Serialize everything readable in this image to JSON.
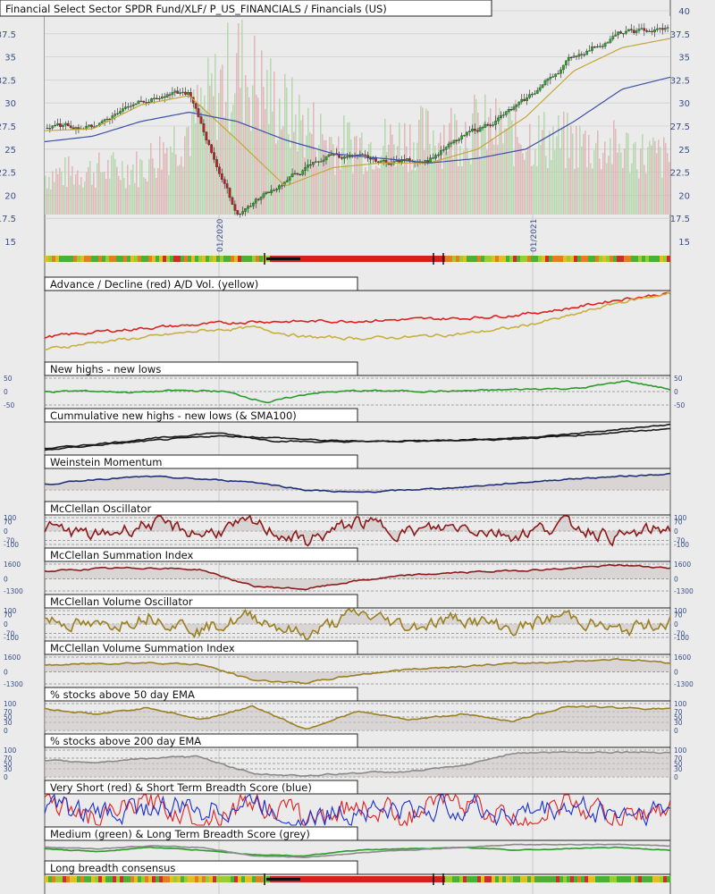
{
  "chart_data": [
    {
      "type": "candlestick",
      "title": "Financial Select Sector SPDR Fund/XLF/ P_US_FINANCIALS / Financials (US)",
      "y_ticks": [
        "40",
        "37.5",
        "35",
        "32.5",
        "30",
        "27.5",
        "25",
        "22.5",
        "20",
        "17.5",
        "15"
      ],
      "ylim": [
        15,
        40
      ],
      "x_date_labels": [
        "01/2020",
        "01/2021"
      ],
      "series": [
        {
          "name": "",
          "role": "price",
          "x": [
            "2019-07",
            "2019-10",
            "2020-01",
            "2020-02",
            "2020-03",
            "2020-04",
            "2020-06",
            "2020-08",
            "2020-10",
            "2020-11",
            "2021-01",
            "2021-03",
            "2021-05",
            "2021-06"
          ],
          "values": [
            27.3,
            27.5,
            30.5,
            31.0,
            18.0,
            21.5,
            24.5,
            23.5,
            24.0,
            27.0,
            30.0,
            35.0,
            37.5,
            38.0
          ]
        },
        {
          "name": "",
          "role": "sma50",
          "color": "#c4a63a",
          "values": [
            27.0,
            27.2,
            29.8,
            30.8,
            26.0,
            21.0,
            23.0,
            23.5,
            23.5,
            25.0,
            28.5,
            33.5,
            36.0,
            37.0
          ]
        },
        {
          "name": "",
          "role": "sma200",
          "color": "#3c50a8",
          "values": [
            25.8,
            26.4,
            28.0,
            29.0,
            28.0,
            26.0,
            24.5,
            24.0,
            23.5,
            24.0,
            25.0,
            28.0,
            31.5,
            32.8
          ]
        }
      ],
      "grid": true
    },
    {
      "type": "line",
      "title": "Advance / Decline (red) A/D Vol. (yellow)",
      "series": [
        {
          "name": "Advance / Decline",
          "color": "#e02020",
          "values": [
            0.3,
            0.38,
            0.45,
            0.5,
            0.55,
            0.55,
            0.56,
            0.58,
            0.6,
            0.65,
            0.75,
            0.9,
            1.0
          ]
        },
        {
          "name": "A/D Vol.",
          "color": "#c8b040",
          "values": [
            0.1,
            0.22,
            0.3,
            0.4,
            0.45,
            0.3,
            0.28,
            0.3,
            0.35,
            0.45,
            0.62,
            0.85,
            1.0
          ]
        }
      ]
    },
    {
      "type": "line",
      "title": "New highs - new lows",
      "y_ticks": [
        "50",
        "0",
        "-50"
      ],
      "ylim": [
        -50,
        50
      ],
      "series": [
        {
          "name": "",
          "color": "#2a9a2a",
          "values": [
            0,
            2,
            -3,
            4,
            1,
            -40,
            -5,
            3,
            2,
            1,
            5,
            10,
            12,
            40,
            8
          ]
        }
      ]
    },
    {
      "type": "line",
      "title": "Cummulative new highs - new lows (& SMA100)",
      "series": [
        {
          "name": "",
          "color": "#1a1a1a",
          "values": [
            0.1,
            0.3,
            0.5,
            0.7,
            0.4,
            0.35,
            0.38,
            0.42,
            0.48,
            0.6,
            0.8,
            1.0
          ]
        },
        {
          "name": "",
          "color": "#1a1a1a",
          "values": [
            0.05,
            0.25,
            0.42,
            0.58,
            0.52,
            0.4,
            0.38,
            0.4,
            0.45,
            0.55,
            0.7,
            0.85
          ]
        }
      ]
    },
    {
      "type": "line",
      "title": "Weinstein Momentum",
      "series": [
        {
          "name": "",
          "color": "#1f2f7a",
          "values": [
            0.5,
            0.7,
            0.8,
            0.7,
            0.6,
            0.3,
            0.2,
            0.3,
            0.4,
            0.55,
            0.7,
            0.8,
            0.9
          ]
        }
      ]
    },
    {
      "type": "line",
      "title": "McClellan Oscillator",
      "y_ticks": [
        "100",
        "70",
        "0",
        "-70",
        "-100"
      ],
      "ylim": [
        -100,
        100
      ],
      "series": [
        {
          "name": "",
          "color": "#8c1a1a",
          "values": [
            30,
            -40,
            60,
            -20,
            50,
            -80,
            70,
            -10,
            40,
            -30,
            60,
            -50,
            30
          ]
        }
      ]
    },
    {
      "type": "line",
      "title": "McClellan Summation Index",
      "y_ticks": [
        "1600",
        "0",
        "-1300"
      ],
      "ylim": [
        -1300,
        1600
      ],
      "series": [
        {
          "name": "",
          "color": "#8c1a1a",
          "values": [
            800,
            1100,
            1200,
            1000,
            -800,
            -1100,
            -200,
            400,
            700,
            900,
            1100,
            1500,
            1200
          ]
        }
      ]
    },
    {
      "type": "line",
      "title": "McClellan Volume Oscillator",
      "y_ticks": [
        "100",
        "70",
        "0",
        "-70",
        "-100"
      ],
      "ylim": [
        -100,
        100
      ],
      "series": [
        {
          "name": "",
          "color": "#9a8020",
          "values": [
            40,
            -30,
            70,
            -40,
            60,
            -90,
            80,
            -20,
            50,
            -40,
            70,
            -60,
            30
          ]
        }
      ]
    },
    {
      "type": "line",
      "title": "McClellan Volume Summation Index",
      "y_ticks": [
        "1600",
        "0",
        "-1300"
      ],
      "ylim": [
        -1300,
        1600
      ],
      "series": [
        {
          "name": "",
          "color": "#9a8020",
          "values": [
            700,
            900,
            1000,
            800,
            -900,
            -1200,
            -300,
            300,
            600,
            900,
            1100,
            1400,
            1000
          ]
        }
      ]
    },
    {
      "type": "line",
      "title": "% stocks above 50 day EMA",
      "y_ticks": [
        "100",
        "70",
        "50",
        "30",
        "0"
      ],
      "ylim": [
        0,
        100
      ],
      "series": [
        {
          "name": "",
          "color": "#9a8020",
          "values": [
            80,
            60,
            85,
            40,
            90,
            5,
            70,
            40,
            60,
            35,
            90,
            85,
            80
          ]
        }
      ]
    },
    {
      "type": "line",
      "title": "% stocks above 200 day EMA",
      "y_ticks": [
        "100",
        "70",
        "50",
        "30",
        "0"
      ],
      "ylim": [
        0,
        100
      ],
      "series": [
        {
          "name": "",
          "color": "#8a8a8a",
          "values": [
            60,
            55,
            70,
            75,
            10,
            5,
            15,
            20,
            40,
            90,
            92,
            93,
            92
          ]
        }
      ]
    },
    {
      "type": "line",
      "title": "Very Short (red) & Short Term Breadth Score (blue)",
      "series": [
        {
          "name": "Very Short",
          "color": "#e02020",
          "values": [
            0.9,
            0.1,
            0.8,
            0.2,
            0.9,
            0.1,
            0.7,
            0.3,
            0.9,
            0.1,
            0.8,
            0.2,
            0.6
          ]
        },
        {
          "name": "Short Term",
          "color": "#1a2fd0",
          "values": [
            0.7,
            0.3,
            0.6,
            0.5,
            0.8,
            0.1,
            0.6,
            0.4,
            0.7,
            0.3,
            0.6,
            0.4,
            0.5
          ]
        }
      ]
    },
    {
      "type": "line",
      "title": "Medium (green) & Long Term Breadth Score (grey)",
      "series": [
        {
          "name": "Medium",
          "color": "#2a9a2a",
          "values": [
            0.6,
            0.4,
            0.7,
            0.5,
            0.2,
            0.1,
            0.5,
            0.6,
            0.7,
            0.5,
            0.6,
            0.7,
            0.5
          ]
        },
        {
          "name": "Long Term",
          "color": "#8a8a8a",
          "values": [
            0.7,
            0.6,
            0.8,
            0.7,
            0.1,
            0.0,
            0.3,
            0.5,
            0.7,
            0.9,
            0.9,
            0.9,
            0.8
          ]
        }
      ]
    },
    {
      "type": "heatmap",
      "title": "Long breadth consensus"
    }
  ]
}
